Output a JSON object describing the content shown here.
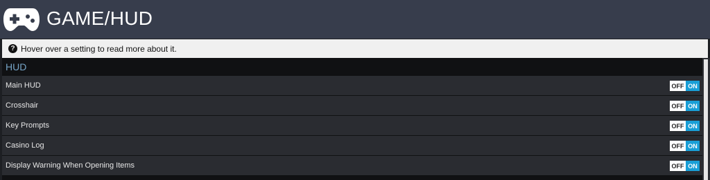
{
  "header": {
    "icon": "gamepad-icon",
    "title": "GAME/HUD"
  },
  "hint": {
    "icon": "question-circle-icon",
    "text": "Hover over a setting to read more about it."
  },
  "section": {
    "title": "HUD"
  },
  "settings": [
    {
      "label": "Main HUD",
      "off_label": "OFF",
      "on_label": "ON",
      "value": "ON"
    },
    {
      "label": "Crosshair",
      "off_label": "OFF",
      "on_label": "ON",
      "value": "ON"
    },
    {
      "label": "Key Prompts",
      "off_label": "OFF",
      "on_label": "ON",
      "value": "ON"
    },
    {
      "label": "Casino Log",
      "off_label": "OFF",
      "on_label": "ON",
      "value": "ON"
    },
    {
      "label": "Display Warning When Opening Items",
      "off_label": "OFF",
      "on_label": "ON",
      "value": "ON"
    }
  ],
  "colors": {
    "header_bg": "#373d4c",
    "accent_on": "#1a9fd6",
    "section_title": "#76a4c6"
  }
}
